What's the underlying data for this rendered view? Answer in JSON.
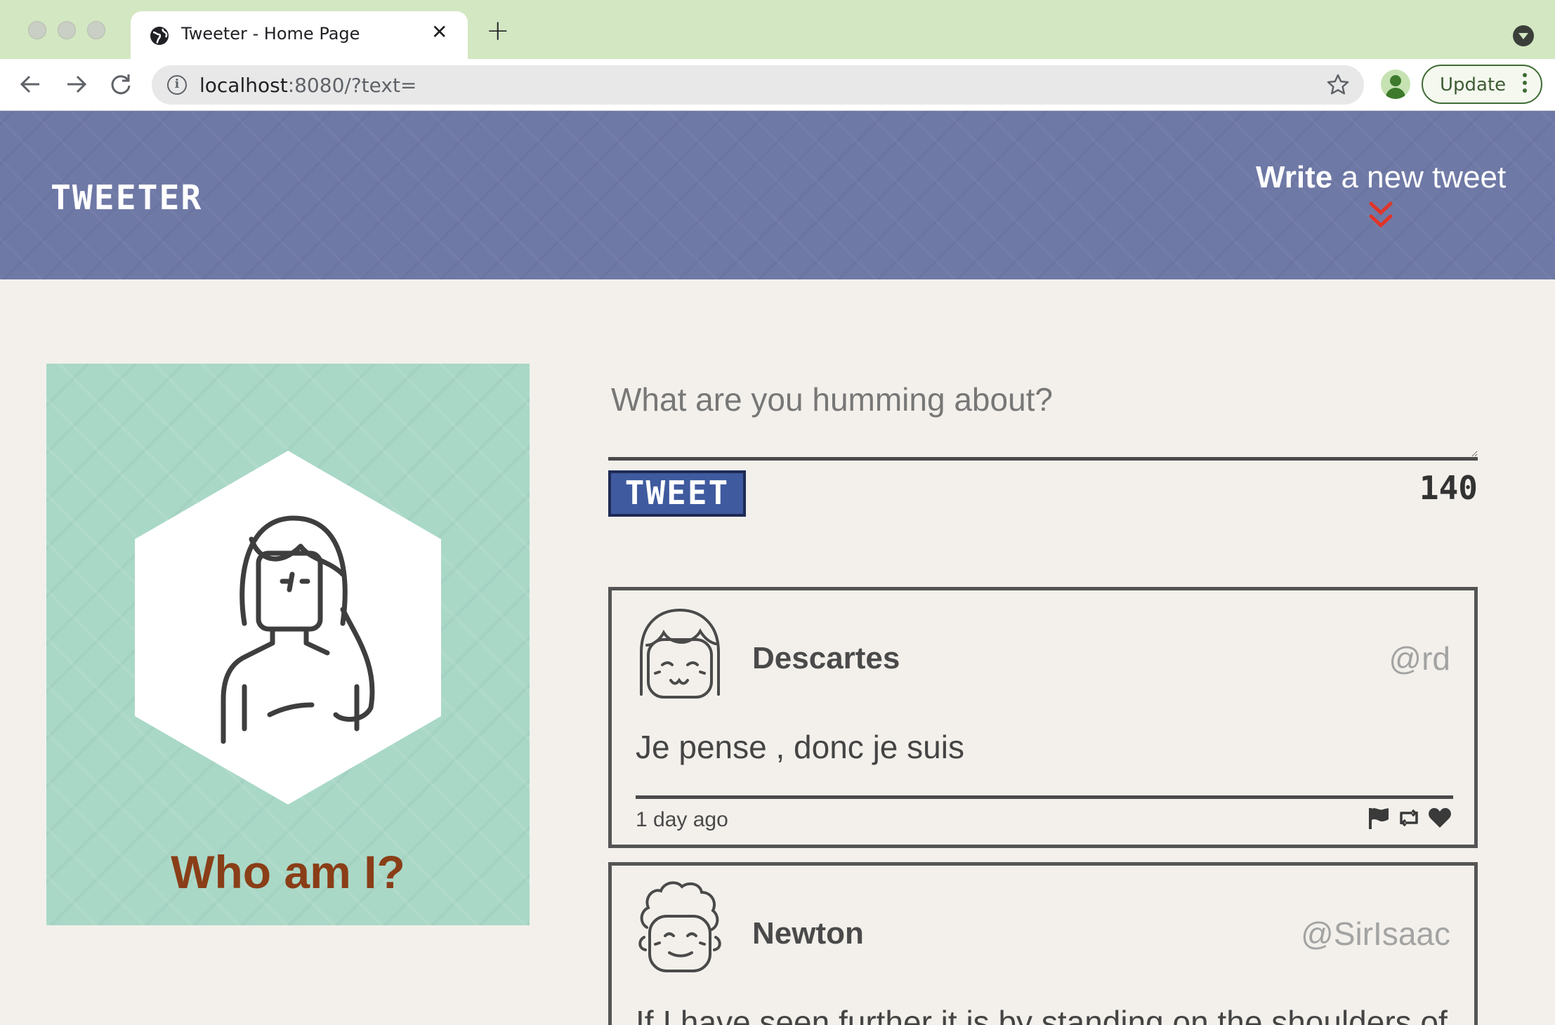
{
  "browser": {
    "tab_title": "Tweeter - Home Page",
    "tab_close": "✕",
    "new_tab": "+",
    "url_host": "localhost",
    "url_rest": ":8080/?text=",
    "update_label": "Update"
  },
  "header": {
    "brand": "TWEETER",
    "compose_strong": "Write",
    "compose_rest": " a new tweet"
  },
  "profile": {
    "heading": "Who am I?"
  },
  "composer": {
    "placeholder": "What are you humming about?",
    "button_label": "TWEET",
    "char_counter": "140"
  },
  "tweets": [
    {
      "name": "Descartes",
      "handle": "@rd",
      "text": "Je pense , donc je suis",
      "time": "1 day ago"
    },
    {
      "name": "Newton",
      "handle": "@SirIsaac",
      "text": "If I have seen further it is by standing on the shoulders of"
    }
  ],
  "colors": {
    "tab_bar": "#d3e7c2",
    "header_bg": "#6f79a6",
    "page_bg": "#f3f0eb",
    "profile_card_bg": "#a9d8c7",
    "heading_brown": "#8a3e17",
    "tweet_button": "#3f5a9e",
    "chevron_red": "#e0352a"
  },
  "icons": {
    "tab_favicon": "globe-icon",
    "back": "arrow-left-icon",
    "forward": "arrow-right-icon",
    "reload": "reload-icon",
    "site_info": "info-icon",
    "bookmark": "star-icon",
    "profile": "person-icon",
    "menu": "kebab-menu-icon",
    "scroll_hint": "double-chevron-down-icon",
    "flag": "flag-icon",
    "retweet": "retweet-icon",
    "like": "heart-icon"
  }
}
